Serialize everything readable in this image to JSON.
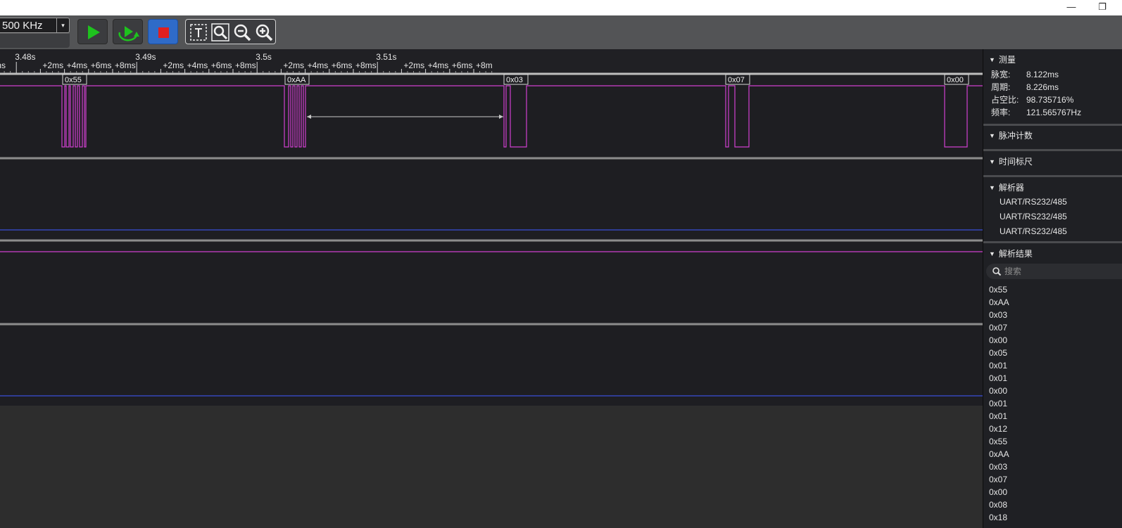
{
  "window": {
    "minimize_glyph": "—",
    "restore_glyph": "❐"
  },
  "toolbar": {
    "sample_rate": "500 KHz",
    "dropdown_glyph": "▾",
    "buttons": [
      {
        "name": "start-capture",
        "icon": "play-icon",
        "color": "#1ec21e"
      },
      {
        "name": "continuous-capture",
        "icon": "loop-play-icon",
        "color": "#1ec21e"
      },
      {
        "name": "stop-capture",
        "icon": "stop-icon",
        "color": "#e02020"
      }
    ],
    "zoom_tools": [
      "text-cursor-icon",
      "zoom-fit-icon",
      "zoom-out-icon",
      "zoom-in-icon"
    ]
  },
  "ruler": {
    "labels": [
      {
        "text": "ms",
        "major": false
      },
      {
        "text": "3.48s",
        "major": true
      },
      {
        "text": "+2ms",
        "major": false
      },
      {
        "text": "+4ms",
        "major": false
      },
      {
        "text": "+6ms",
        "major": false
      },
      {
        "text": "+8ms",
        "major": false
      },
      {
        "text": "3.49s",
        "major": true
      },
      {
        "text": "+2ms",
        "major": false
      },
      {
        "text": "+4ms",
        "major": false
      },
      {
        "text": "+6ms",
        "major": false
      },
      {
        "text": "+8ms",
        "major": false
      },
      {
        "text": "3.5s",
        "major": true
      },
      {
        "text": "+2ms",
        "major": false
      },
      {
        "text": "+4ms",
        "major": false
      },
      {
        "text": "+6ms",
        "major": false
      },
      {
        "text": "+8ms",
        "major": false
      },
      {
        "text": "3.51s",
        "major": true
      },
      {
        "text": "+2ms",
        "major": false
      },
      {
        "text": "+4ms",
        "major": false
      },
      {
        "text": "+6ms",
        "major": false
      },
      {
        "text": "+8m",
        "major": false
      }
    ]
  },
  "decoded_frames": [
    "0x55",
    "0xAA",
    "0x03",
    "0x07",
    "0x00"
  ],
  "colors": {
    "signal": "#d040d0",
    "baseline_blue": "#3a4fd8",
    "measure_arrow": "#c8c8c8"
  },
  "panel": {
    "measure": {
      "title": "测量",
      "rows": [
        {
          "key": "脉宽:",
          "value": "8.122ms"
        },
        {
          "key": "周期:",
          "value": "8.226ms"
        },
        {
          "key": "占空比:",
          "value": "98.735716%"
        },
        {
          "key": "频率:",
          "value": "121.565767Hz"
        }
      ]
    },
    "pulse_count": {
      "title": "脉冲计数"
    },
    "time_ruler": {
      "title": "时间标尺"
    },
    "decoders": {
      "title": "解析器",
      "items": [
        "UART/RS232/485",
        "UART/RS232/485",
        "UART/RS232/485"
      ]
    },
    "results": {
      "title": "解析结果",
      "search_placeholder": "搜索",
      "items": [
        "0x55",
        "0xAA",
        "0x03",
        "0x07",
        "0x00",
        "0x05",
        "0x01",
        "0x01",
        "0x00",
        "0x01",
        "0x01",
        "0x12",
        "0x55",
        "0xAA",
        "0x03",
        "0x07",
        "0x00",
        "0x08",
        "0x18"
      ]
    }
  }
}
